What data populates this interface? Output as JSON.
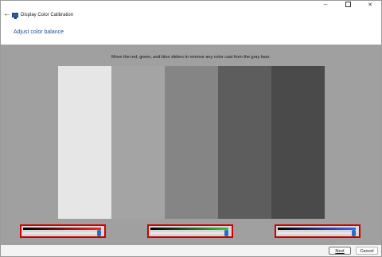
{
  "window": {
    "title": "Display Color Calibration",
    "back_icon": "arrow-left-icon",
    "app_icon": "display-calibration-icon",
    "minimize_glyph": "─",
    "close_glyph": "✕"
  },
  "page": {
    "heading": "Adjust color balance",
    "instructions": "Move the red, green, and blue sliders to remove any color cast from the gray bars."
  },
  "gray_bars": [
    {
      "color": "#e6e6e6"
    },
    {
      "color": "#a4a4a4"
    },
    {
      "color": "#858585"
    },
    {
      "color": "#5d5d5d"
    },
    {
      "color": "#4a4a4a"
    }
  ],
  "sliders": [
    {
      "channel": "red",
      "value": 1.0,
      "gradient": [
        "#000000",
        "#ff2020"
      ],
      "highlight": "#d00000"
    },
    {
      "channel": "green",
      "value": 1.0,
      "gradient": [
        "#000000",
        "#40c040"
      ],
      "highlight": "#d00000"
    },
    {
      "channel": "blue",
      "value": 1.0,
      "gradient": [
        "#000000",
        "#4060ff"
      ],
      "highlight": "#d00000"
    }
  ],
  "footer": {
    "next_label": "Next",
    "cancel_label": "Cancel"
  }
}
